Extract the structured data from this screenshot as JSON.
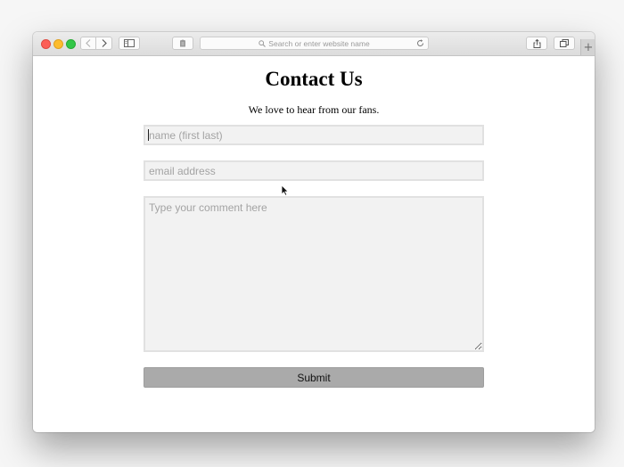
{
  "browser": {
    "address_placeholder": "Search or enter website name",
    "new_tab_label": "+"
  },
  "page": {
    "heading": "Contact Us",
    "subtitle": "We love to hear from our fans."
  },
  "form": {
    "name_placeholder": "name (first last)",
    "email_placeholder": "email address",
    "comment_placeholder": "Type your comment here",
    "submit_label": "Submit"
  }
}
